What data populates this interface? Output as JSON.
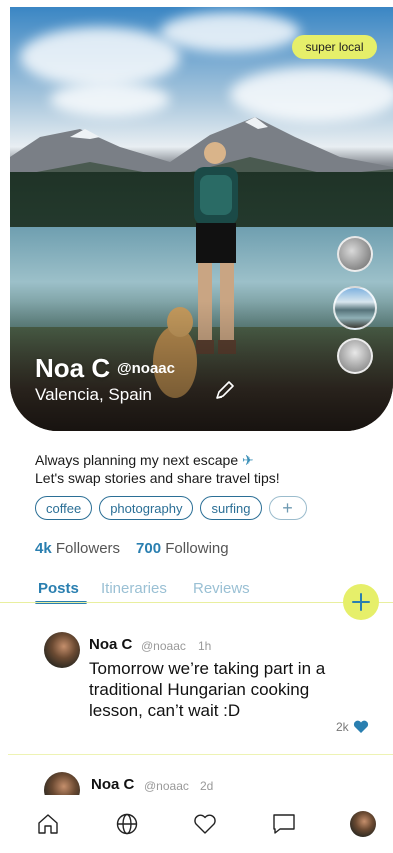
{
  "hero": {
    "badge": "super local",
    "name": "Noa C",
    "handle": "@noaac",
    "location": "Valencia, Spain"
  },
  "bio": {
    "line1": "Always planning my next escape",
    "line2": "Let's swap stories and share travel tips!"
  },
  "tags": [
    "coffee",
    "photography",
    "surfing"
  ],
  "tag_add_label": "+",
  "stats": {
    "followers_count": "4k",
    "followers_label": "Followers",
    "following_count": "700",
    "following_label": "Following"
  },
  "tabs": [
    "Posts",
    "Itineraries",
    "Reviews"
  ],
  "active_tab": "Posts",
  "posts": [
    {
      "author": "Noa C",
      "handle": "@noaac",
      "time": "1h",
      "body": "Tomorrow we’re taking part in a traditional Hungarian cooking lesson, can’t wait :D",
      "likes": "2k"
    },
    {
      "author": "Noa C",
      "handle": "@noaac",
      "time": "2d"
    }
  ],
  "nav": [
    "home-icon",
    "globe-icon",
    "heart-icon",
    "chat-icon",
    "profile-avatar"
  ],
  "colors": {
    "accent": "#2a7fb0",
    "highlight": "#e6ef6a",
    "like": "#2a7fb0"
  }
}
